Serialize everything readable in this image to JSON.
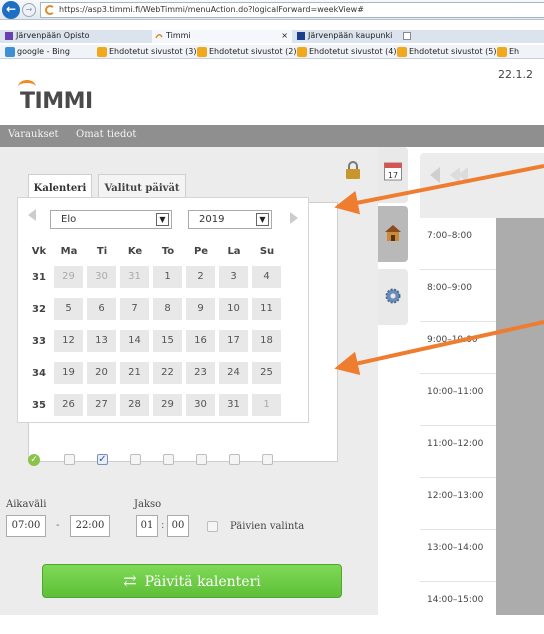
{
  "browser": {
    "url": "https://asp3.timmi.fi/WebTimmi/menuAction.do?logicalForward=weekView#",
    "tabs": [
      {
        "label": "Järvenpään Opisto"
      },
      {
        "label": "Timmi"
      },
      {
        "label": "Järvenpään kaupunki"
      }
    ],
    "tab_close": "×",
    "favorites": [
      {
        "label": "google - Bing"
      },
      {
        "label": "Ehdotetut sivustot (3) ▾"
      },
      {
        "label": "Ehdotetut sivustot (2) ▾"
      },
      {
        "label": "Ehdotetut sivustot (4) ▾"
      },
      {
        "label": "Ehdotetut sivustot (5) ▾"
      },
      {
        "label": "Eh"
      }
    ]
  },
  "header": {
    "logo_text": "TIMMI",
    "date": "22.1.2"
  },
  "menu": {
    "items": [
      {
        "label": "Varaukset"
      },
      {
        "label": "Omat tiedot"
      }
    ]
  },
  "panel": {
    "tabs": [
      {
        "label": "Kalenteri"
      },
      {
        "label": "Valitut päivät"
      }
    ],
    "calendar": {
      "month": "Elo",
      "year": "2019",
      "headers": [
        "Vk",
        "Ma",
        "Ti",
        "Ke",
        "To",
        "Pe",
        "La",
        "Su"
      ],
      "weeks": [
        {
          "no": "31",
          "days": [
            "29",
            "30",
            "31",
            "1",
            "2",
            "3",
            "4"
          ]
        },
        {
          "no": "32",
          "days": [
            "5",
            "6",
            "7",
            "8",
            "9",
            "10",
            "11"
          ]
        },
        {
          "no": "33",
          "days": [
            "12",
            "13",
            "14",
            "15",
            "16",
            "17",
            "18"
          ]
        },
        {
          "no": "34",
          "days": [
            "19",
            "20",
            "21",
            "22",
            "23",
            "24",
            "25"
          ]
        },
        {
          "no": "35",
          "days": [
            "26",
            "27",
            "28",
            "29",
            "30",
            "31",
            "1"
          ]
        }
      ]
    },
    "weekday_checks": {
      "ok_mark": "✓",
      "checked_mark": "✓"
    },
    "time": {
      "interval_label": "Aikaväli",
      "period_label": "Jakso",
      "start": "07:00",
      "dash": "-",
      "end": "22:00",
      "period_hours": "01",
      "colon": ":",
      "period_minutes": "00",
      "day_select_label": "Päivien valinta"
    },
    "refresh_button": {
      "icon": "⇄",
      "label": "Päivitä kalenteri"
    }
  },
  "side_icons": {
    "calendar_icon_day": "17"
  },
  "week_view": {
    "slots": [
      "7:00–8:00",
      "8:00–9:00",
      "9:00–10:00",
      "10:00–11:00",
      "11:00–12:00",
      "12:00–13:00",
      "13:00–14:00",
      "14:00–15:00"
    ]
  },
  "colors": {
    "menu_bg": "#8f8f8f",
    "refresh_green": "#6fcf45",
    "arrow_orange": "#ee7d2f",
    "logo_orange": "#f08a24"
  }
}
